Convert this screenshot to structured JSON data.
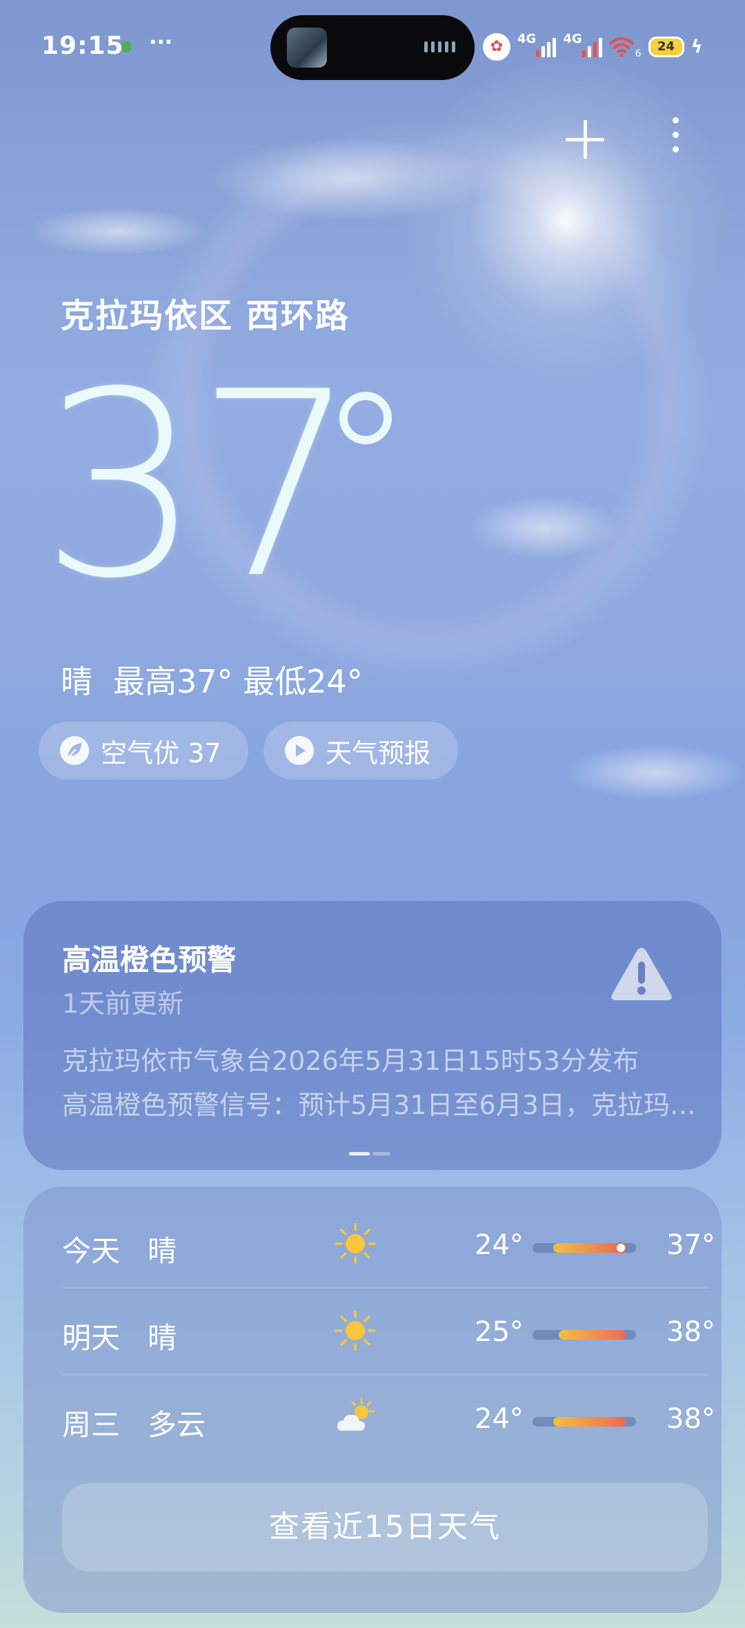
{
  "status_bar": {
    "time": "19:15",
    "dots": "···",
    "network_1": "4G",
    "network_2": "4G",
    "wifi_sub": "6",
    "battery": "24",
    "charging_icon": "bolt-icon"
  },
  "header": {
    "add_icon": "plus-icon",
    "menu_icon": "more-vertical-icon"
  },
  "current": {
    "location": "克拉玛依区 西环路",
    "temperature": "37",
    "condition": "晴",
    "high_low": "最高37° 最低24°",
    "air_quality": "空气优 37",
    "forecast_video": "天气预报"
  },
  "alert": {
    "title": "高温橙色预警",
    "updated": "1天前更新",
    "line1": "克拉玛依市气象台2026年5月31日15时53分发布",
    "line2": "高温橙色预警信号：预计5月31日至6月3日，克拉玛依…",
    "page": 1,
    "page_count": 2
  },
  "forecast": {
    "days": [
      {
        "name": "今天",
        "cond": "晴",
        "icon": "sun-icon",
        "low": "24°",
        "high": "37°",
        "low_val": 24,
        "high_val": 37,
        "current": 37
      },
      {
        "name": "明天",
        "cond": "晴",
        "icon": "sun-icon",
        "low": "25°",
        "high": "38°",
        "low_val": 25,
        "high_val": 38
      },
      {
        "name": "周三",
        "cond": "多云",
        "icon": "partly-cloudy-icon",
        "low": "24°",
        "high": "38°",
        "low_val": 24,
        "high_val": 38
      }
    ],
    "range_min": 20,
    "range_max": 40,
    "view_more": "查看近15日天气"
  },
  "colors": {
    "bar_start": "#f2c040",
    "bar_end": "#ee6a55",
    "alert_icon": "#d0d8ea"
  }
}
